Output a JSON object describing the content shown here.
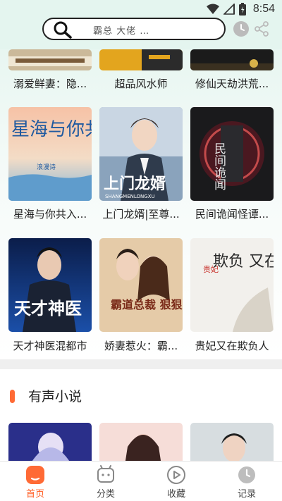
{
  "status_bar": {
    "time": "8:54"
  },
  "search": {
    "placeholder": "霸总 大佬 …"
  },
  "novels": {
    "row_partial": [
      {
        "title": "溺爱鲜妻：隐..."
      },
      {
        "title": "超品风水师"
      },
      {
        "title": "修仙天劫洪荒..."
      }
    ],
    "row2": [
      {
        "title": "星海与你共入...",
        "cover_text": "星海与你共入梦",
        "cover_sub": "浪漫诗"
      },
      {
        "title": "上门龙婿|至尊...",
        "cover_text": "上门龙婿",
        "cover_sub": "SHANGMENLONGXU"
      },
      {
        "title": "民间诡闻怪谭...",
        "cover_text": "民间诡闻",
        "cover_sub": ""
      }
    ],
    "row3": [
      {
        "title": "天才神医混都市",
        "cover_text": "天才神医",
        "cover_sub": ""
      },
      {
        "title": "娇妻惹火：霸...",
        "cover_text": "霸道总裁 狠狠宠",
        "cover_sub": ""
      },
      {
        "title": "贵妃又在欺负人",
        "cover_text": "欺负 又在 人",
        "cover_sub": "贵妃"
      }
    ]
  },
  "audio_section": {
    "heading": "有声小说"
  },
  "tabs": [
    {
      "label": "首页",
      "icon": "home-icon",
      "active": true
    },
    {
      "label": "分类",
      "icon": "category-icon",
      "active": false
    },
    {
      "label": "收藏",
      "icon": "favorite-play-icon",
      "active": false
    },
    {
      "label": "记录",
      "icon": "history-clock-icon",
      "active": false
    }
  ],
  "colors": {
    "accent": "#ff6a35",
    "header_bg": "#e4f5ef"
  }
}
